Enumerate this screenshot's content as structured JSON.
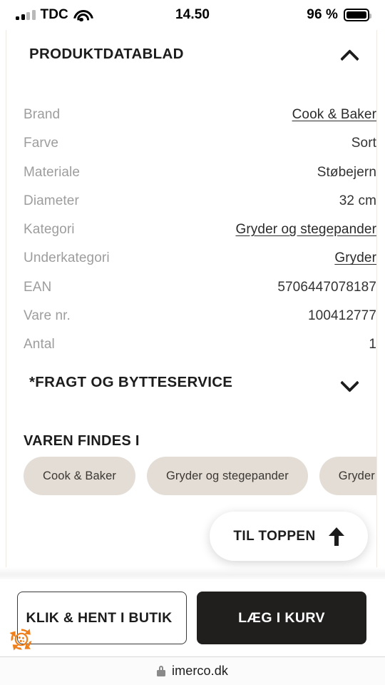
{
  "status_bar": {
    "carrier": "TDC",
    "time": "14.50",
    "battery_percent": "96 %",
    "signal_icon": "signal-bars-icon",
    "wifi_icon": "wifi-icon",
    "battery_icon": "battery-icon"
  },
  "datasheet": {
    "title": "PRODUKTDATABLAD",
    "toggle_icon": "chevron-up-icon",
    "rows": [
      {
        "label": "Brand",
        "value": "Cook & Baker",
        "is_link": true
      },
      {
        "label": "Farve",
        "value": "Sort",
        "is_link": false
      },
      {
        "label": "Materiale",
        "value": "Støbejern",
        "is_link": false
      },
      {
        "label": "Diameter",
        "value": "32 cm",
        "is_link": false
      },
      {
        "label": "Kategori",
        "value": "Gryder og stegepander",
        "is_link": true
      },
      {
        "label": "Underkategori",
        "value": "Gryder",
        "is_link": true
      },
      {
        "label": "EAN",
        "value": "5706447078187",
        "is_link": false
      },
      {
        "label": "Vare nr.",
        "value": "100412777",
        "is_link": false
      },
      {
        "label": "Antal",
        "value": "1",
        "is_link": false
      }
    ]
  },
  "shipping": {
    "title": "*FRAGT OG BYTTESERVICE",
    "toggle_icon": "chevron-down-icon"
  },
  "found_in": {
    "title": "VAREN FINDES I",
    "chips": [
      {
        "label": "Cook & Baker"
      },
      {
        "label": "Gryder og stegepander"
      },
      {
        "label": "Gryder"
      }
    ]
  },
  "to_top_button": {
    "label": "TIL TOPPEN",
    "icon": "arrow-up-icon"
  },
  "action_bar": {
    "secondary_label": "KLIK & HENT I BUTIK",
    "primary_label": "LÆG I KURV"
  },
  "cookie_widget": {
    "icon": "cookie-consent-icon"
  },
  "browser": {
    "lock_icon": "lock-icon",
    "domain": "imerco.dk"
  },
  "colors": {
    "chip_bg": "#e4ddd5",
    "label_gray": "#9d9d9d",
    "primary_button_bg": "#211f1e",
    "cookie_orange": "#ef7f1a"
  }
}
